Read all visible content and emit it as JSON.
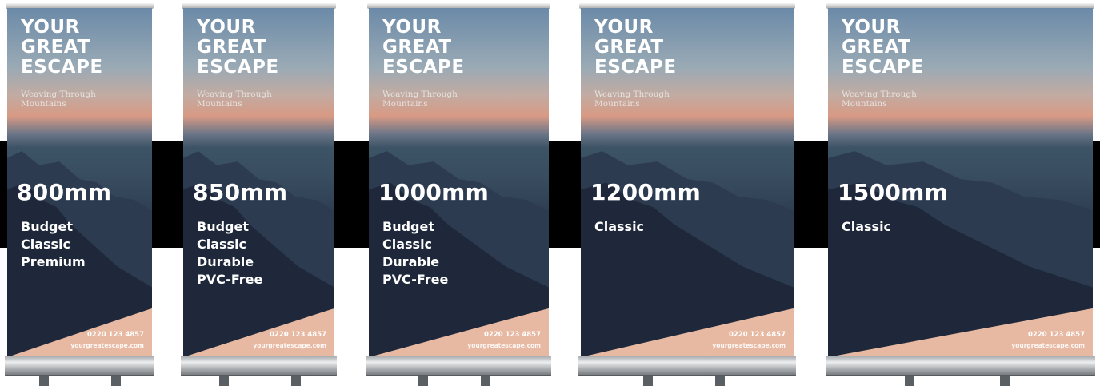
{
  "banners": [
    {
      "headline": "YOUR\nGREAT\nESCAPE",
      "subtitle": "Weaving Through\nMountains",
      "size": "800mm",
      "variants": [
        "Budget",
        "Classic",
        "Premium"
      ],
      "phone": "0220 123 4857",
      "website": "yourgreatescape.com"
    },
    {
      "headline": "YOUR\nGREAT\nESCAPE",
      "subtitle": "Weaving Through\nMountains",
      "size": "850mm",
      "variants": [
        "Budget",
        "Classic",
        "Durable",
        "PVC-Free"
      ],
      "phone": "0220 123 4857",
      "website": "yourgreatescape.com"
    },
    {
      "headline": "YOUR\nGREAT\nESCAPE",
      "subtitle": "Weaving Through\nMountains",
      "size": "1000mm",
      "variants": [
        "Budget",
        "Classic",
        "Durable",
        "PVC-Free"
      ],
      "phone": "0220 123 4857",
      "website": "yourgreatescape.com"
    },
    {
      "headline": "YOUR\nGREAT\nESCAPE",
      "subtitle": "Weaving Through\nMountains",
      "size": "1200mm",
      "variants": [
        "Classic"
      ],
      "phone": "0220 123 4857",
      "website": "yourgreatescape.com"
    },
    {
      "headline": "YOUR\nGREAT\nESCAPE",
      "subtitle": "Weaving Through\nMountains",
      "size": "1500mm",
      "variants": [
        "Classic"
      ],
      "phone": "0220 123 4857",
      "website": "yourgreatescape.com"
    }
  ],
  "colors": {
    "band": "#000000",
    "peach_accent": "#e8b9a2",
    "text": "#ffffff"
  }
}
